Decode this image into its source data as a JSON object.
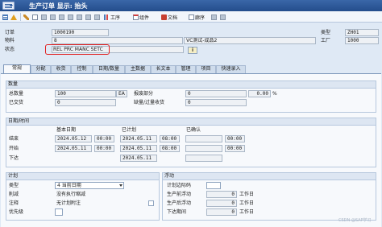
{
  "window": {
    "title": "生产订单 显示: 抬头"
  },
  "toolbar": {
    "work": "工序",
    "components": "组件",
    "documents": "文档",
    "table": "廊序"
  },
  "header": {
    "order_label": "订单",
    "order_value": "1000190",
    "type_label": "类型",
    "type_value": "ZH01",
    "material_label": "物料",
    "material_value": "8",
    "material_desc": "VC测试-成品2",
    "plant_label": "工厂",
    "plant_value": "1000",
    "status_label": "状态",
    "status_value": "REL  PRC  MANC SETC"
  },
  "tabs": [
    "常规",
    "分配",
    "收货",
    "控制",
    "日期/数量",
    "主数据",
    "长文本",
    "管理",
    "项目",
    "快速录入"
  ],
  "quantity": {
    "title": "数量",
    "total_label": "总数量",
    "total_value": "100",
    "unit": "EA",
    "scrap_label": "报废部分",
    "scrap_value": "0",
    "scrap_pct": "0.00",
    "pct_sign": "%",
    "delivered_label": "已交货",
    "delivered_value": "0",
    "short_label": "缺量/过量收货",
    "short_value": "0"
  },
  "dates": {
    "title": "日期/时间",
    "col_basic": "基本日期",
    "col_scheduled": "已计划",
    "col_confirmed": "已确认",
    "end_label": "结束",
    "end_date": "2024.05.12",
    "end_time": "00:00",
    "end_sched_date": "2024.05.11",
    "end_sched_time": "08:00",
    "end_conf_time": "00:00",
    "start_label": "开始",
    "start_date": "2024.05.11",
    "start_time": "00:00",
    "start_sched_date": "2024.05.11",
    "start_sched_time": "08:00",
    "start_conf_time": "00:00",
    "release_label": "下达",
    "release_sched_date": "2024.05.11"
  },
  "planning": {
    "title": "计划",
    "type_label": "类型",
    "type_value": "4 当前日期",
    "reduction_label": "削减",
    "reduction_value": "没有执行缩减",
    "note_label": "注释",
    "note_value": "无计划附注",
    "priority_label": "优先级"
  },
  "float": {
    "title": "浮动",
    "margin_label": "计划边际码",
    "before_label": "生产前浮动",
    "before_value": "0",
    "before_unit": "工作日",
    "after_label": "生产后浮动",
    "after_value": "0",
    "after_unit": "工作日",
    "release_label": "下达期间",
    "release_value": "0",
    "release_unit": "工作日"
  },
  "watermark": "CSDN @SAP学习"
}
